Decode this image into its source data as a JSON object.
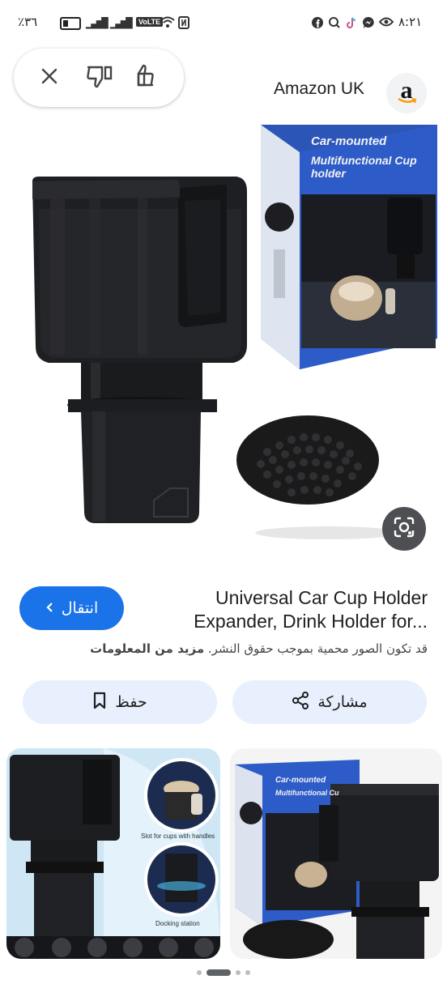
{
  "status_bar": {
    "battery_text": "٪٣٦",
    "time": "٨:٢١",
    "volte": "VoLTE",
    "left_icons": [
      "battery-icon",
      "signal-icon",
      "signal-icon",
      "volte-icon",
      "wifi-icon",
      "nfc-icon"
    ],
    "right_icons": [
      "facebook-icon",
      "messenger-icon",
      "tiktok-icon",
      "search-app-icon",
      "facebook-icon",
      "eye-icon"
    ]
  },
  "feedback": {
    "icons": [
      "close-icon",
      "thumbs-down-icon",
      "thumbs-up-icon"
    ]
  },
  "source": {
    "name": "Amazon UK",
    "logo_letter": "a"
  },
  "main_image": {
    "box_text_line1": "Car-mounted",
    "box_text_line2": "Multifunctional Cup holder"
  },
  "product": {
    "title_line1": "Universal Car Cup Holder",
    "title_line2": "Expander, Drink Holder for...",
    "visit_label": "انتقال",
    "copyright_text": "قد تكون الصور محمية بموجب حقوق النشر.",
    "learn_more": "مزيد من المعلومات"
  },
  "actions": {
    "share_label": "مشاركة",
    "save_label": "حفظ"
  },
  "thumbs": {
    "left_caption1": "Slot for cups with handles",
    "left_caption2": "Docking station",
    "right_box_line1": "Car-mounted",
    "right_box_line2": "Multifunctional Cu"
  },
  "colors": {
    "accent": "#1a73e8",
    "pill_bg": "#e8f0fe",
    "lens_bg": "#4d4f52"
  }
}
